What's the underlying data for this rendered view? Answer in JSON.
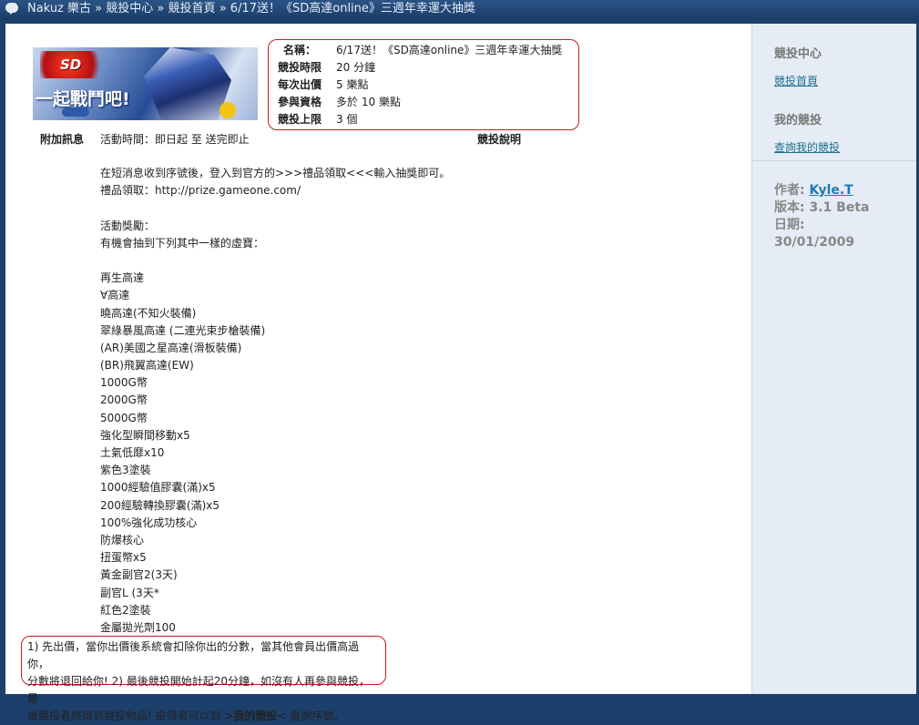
{
  "breadcrumb": {
    "site": "Nakuz 樂古",
    "sep": "»",
    "items": [
      "競投中心",
      "競投首頁",
      "6/17送！《SD高達online》三週年幸運大抽獎"
    ]
  },
  "banner": {
    "logo_text": "SD",
    "tagline": "一起戰鬥吧!"
  },
  "info": {
    "rows": [
      {
        "label": "名稱：",
        "value": "6/17送！《SD高達online》三週年幸運大抽獎"
      },
      {
        "label": "競投時限",
        "value": "20 分鐘"
      },
      {
        "label": "每次出價",
        "value": "5 樂點"
      },
      {
        "label": "參與資格",
        "value": "多於 10 樂點"
      },
      {
        "label": "競投上限",
        "value": "3 個"
      }
    ]
  },
  "extra": {
    "label": "附加訊息",
    "time": "活動時間：即日起 至 送完即止",
    "desc_title": "競投說明"
  },
  "description": [
    "在短消息收到序號後，登入到官方的>>>禮品領取<<<輸入抽獎即可。",
    "禮品領取：http://prize.gameone.com/",
    "",
    "活動獎勵：",
    "有機會抽到下列其中一樣的虛寶：",
    "",
    "再生高達",
    "∀高達",
    "曉高達(不知火裝備)",
    "翠綠暴風高達 (二連光束步槍裝備)",
    "(AR)美國之星高達(滑板裝備)",
    "(BR)飛翼高達(EW)",
    "1000G幣",
    "2000G幣",
    "5000G幣",
    "強化型瞬間移動x5",
    "土氣低靡x10",
    "紫色3塗裝",
    "1000經驗值膠囊(滿)x5",
    "200經驗轉換膠囊(滿)x5",
    "100%強化成功核心",
    "防爆核心",
    "扭蛋幣x5",
    "黃金副官2(3天)",
    "副官L (3天*",
    "紅色2塗裝",
    "金屬拋光劑100"
  ],
  "rules": {
    "line1": "1) 先出價，當你出價後系統會扣除你出的分數，當其他會員出價高過你，",
    "line2": "分數將退回給你! 2) 最後競投開始計起20分鐘，如沒有人再參與競投，最",
    "line3_pre": "後競投者將得到競投物品! 投得者可以到 >",
    "line3_link": "我的競投",
    "line3_post": "< 查詢序號。"
  },
  "sidebar": {
    "section1_title": "競投中心",
    "link_home": "競投首頁",
    "section2_title": "我的競投",
    "link_my": "查詢我的競投",
    "author_label": "作者:",
    "author": "Kyle.T",
    "version_label": "版本:",
    "version": "3.1 Beta",
    "date_label": "日期:",
    "date": "30/01/2009"
  }
}
